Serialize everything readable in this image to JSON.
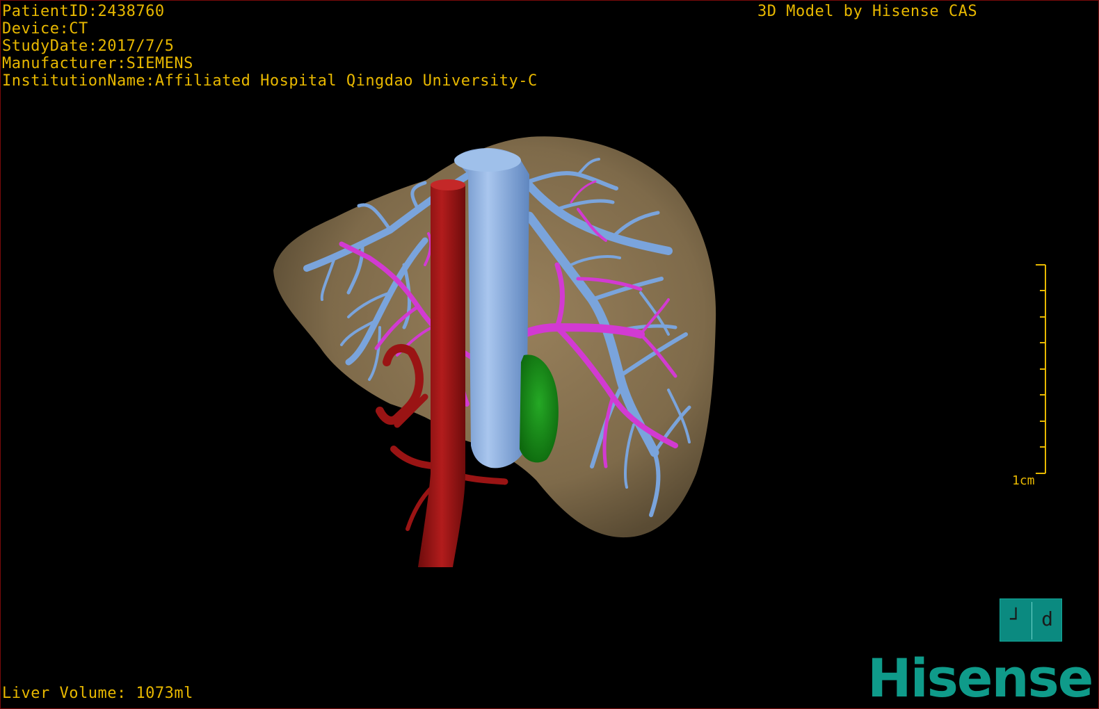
{
  "overlay": {
    "patient_id": "PatientID:2438760",
    "device": "Device:CT",
    "study_date": "StudyDate:2017/7/5",
    "manufacturer": "Manufacturer:SIEMENS",
    "institution": "InstitutionName:Affiliated Hospital Qingdao University-C",
    "credit": "3D Model by Hisense CAS",
    "liver_volume": "Liver Volume: 1073ml"
  },
  "scale_bar": {
    "label": "1cm",
    "color": "#e8b800"
  },
  "orientation_cube": {
    "left_glyph": "┘",
    "right_glyph": "d",
    "color": "#0b8a80"
  },
  "logo": {
    "text": "Hisense",
    "color": "#0f9b8a"
  },
  "model_colors": {
    "liver": "#8a7350",
    "hepatic_veins": "#7aa4dc",
    "portal_vein": "#d23ad2",
    "aorta": "#9a1414",
    "gallbladder": "#1a8a1a",
    "background": "#000000",
    "text": "#e8b800"
  }
}
